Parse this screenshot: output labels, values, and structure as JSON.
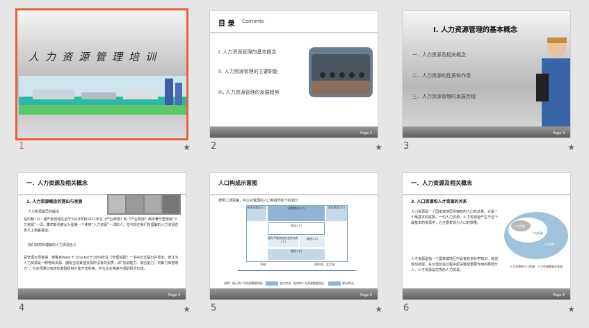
{
  "slides": [
    {
      "number": "1",
      "title": "人力资源管理培训"
    },
    {
      "number": "2",
      "toc_title": "目 录",
      "toc_sub": "Contents",
      "items": [
        "I.  人力资源管理的基本概念",
        "II.  人力资源管理的主要职能",
        "III.  人力资源管理的发展趋势"
      ],
      "page": "Page 2"
    },
    {
      "number": "3",
      "title": "I.   人力资源管理的基本概念",
      "items": [
        "一．人力资源及相关概念",
        "二．人力资源的性质和作用",
        "三．人力资源管理的发展历程"
      ],
      "page": "Page 3"
    },
    {
      "number": "4",
      "title": "一．人力资源及相关概念",
      "sub": "1.  人力资源概念的提出与发展",
      "b1": "人力资源最早的提出",
      "p1": "是约翰・R・康芒斯曾经先后于1919年和1921年在《产业荣誉》和《产业政府》两本著作里使用“人力资源”一词，康芒斯也被认为是第一个使用“人力资源”一词的人。但与现在我们所理解的人力资源在含义上相差甚远。",
      "b2": "我们目前所理解的人力资源含义",
      "p2": "是管理大师彼得．德鲁克Peter F. Drucker于1954年在《管理实践》一书中正式提出并界定。他认为人力资源是一种特殊资源，拥有当前其他资源所没有的素质，即“协调能力、融合能力、判断力和想象力”，它必须通过有效的激励机制才能开发利用，并为企业带来可观的经济价值。",
      "page": "Page 4"
    },
    {
      "number": "5",
      "title": "人口构成示意图",
      "intro": "按照上述思路，可以对我国的人口构成作如下的划分",
      "labels": [
        "未成年就业人口",
        "适龄就业人口",
        "老年就业人口",
        "失业人口",
        "暂时不能参加社会劳动的人口",
        "其他人口",
        "就学人口",
        "家务劳动人口",
        "军队人口",
        "其他人口"
      ],
      "axis": [
        "16岁",
        "男60岁，女55岁"
      ],
      "legend": [
        "说明：图示的人力资源数量包括",
        "部分劳动、现实的人力资源数量包括",
        "部分劳动。"
      ],
      "page": "Page 5"
    },
    {
      "number": "6",
      "title": "一．人力资源及相关概念",
      "sub": "3.  人口资源和人才资源的关系",
      "b1": "人口资源是一个国家或地区所拥有的人口的总量，它是一个最基本的底数，一切人力资源、人才资源皆产生于这个最基本的资源中，它主要表现为人口的数量。",
      "b2": "人才资源是指一个国家或地区中具有较多科学知识、较强劳动技能，在价值创造过程中起关键或重要作用的那部分人。人才资源是优秀的人力资源。",
      "circles": [
        "人才资源",
        "人力资源",
        "人口资源"
      ],
      "caption": "人力资源和人口资源、人才资源数量关系图",
      "page": "Page 6"
    }
  ]
}
